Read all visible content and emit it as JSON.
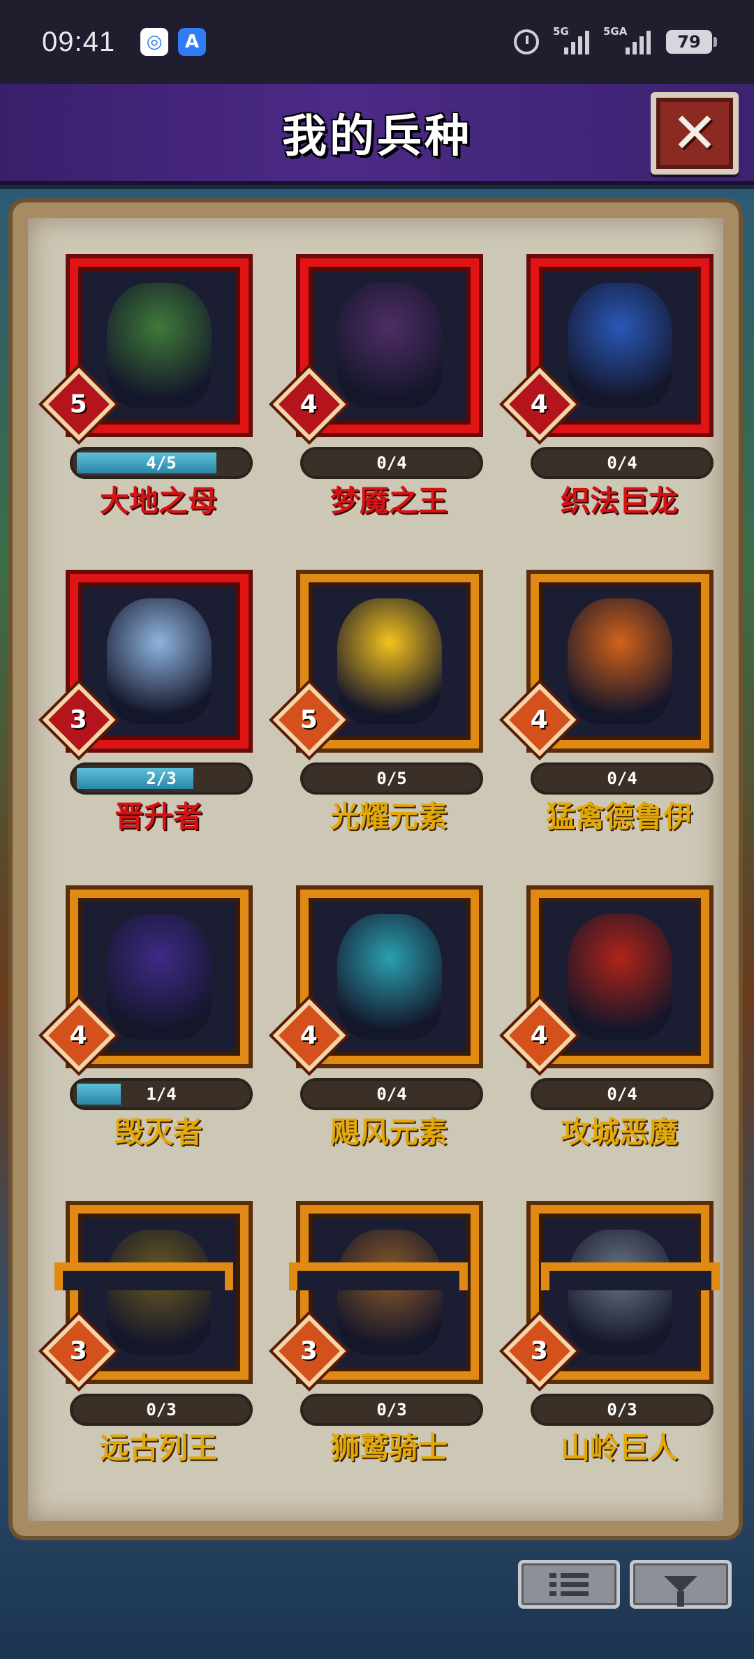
{
  "status_bar": {
    "time": "09:41",
    "battery": "79",
    "signal1_label": "5G",
    "signal2_label": "5GA"
  },
  "header": {
    "title": "我的兵种",
    "close_icon": "close-icon"
  },
  "units": [
    {
      "name": "大地之母",
      "level": "5",
      "progress": "4/5",
      "progress_value": 0.8,
      "rarity": "red"
    },
    {
      "name": "梦魇之王",
      "level": "4",
      "progress": "0/4",
      "progress_value": 0,
      "rarity": "red"
    },
    {
      "name": "织法巨龙",
      "level": "4",
      "progress": "0/4",
      "progress_value": 0,
      "rarity": "red"
    },
    {
      "name": "晋升者",
      "level": "3",
      "progress": "2/3",
      "progress_value": 0.667,
      "rarity": "red"
    },
    {
      "name": "光耀元素",
      "level": "5",
      "progress": "0/5",
      "progress_value": 0,
      "rarity": "gold"
    },
    {
      "name": "猛禽德鲁伊",
      "level": "4",
      "progress": "0/4",
      "progress_value": 0,
      "rarity": "gold"
    },
    {
      "name": "毁灭者",
      "level": "4",
      "progress": "1/4",
      "progress_value": 0.25,
      "rarity": "gold"
    },
    {
      "name": "飓风元素",
      "level": "4",
      "progress": "0/4",
      "progress_value": 0,
      "rarity": "gold"
    },
    {
      "name": "攻城恶魔",
      "level": "4",
      "progress": "0/4",
      "progress_value": 0,
      "rarity": "gold"
    },
    {
      "name": "远古列王",
      "level": "3",
      "progress": "0/3",
      "progress_value": 0,
      "rarity": "gold"
    },
    {
      "name": "狮鹫骑士",
      "level": "3",
      "progress": "0/3",
      "progress_value": 0,
      "rarity": "gold"
    },
    {
      "name": "山岭巨人",
      "level": "3",
      "progress": "0/3",
      "progress_value": 0,
      "rarity": "gold"
    }
  ],
  "art_colors": [
    "#3f7a3a",
    "#4e2d66",
    "#2a58b8",
    "#8fb4e0",
    "#f4c21c",
    "#d2621a",
    "#3e2a86",
    "#2aa0b0",
    "#b02418",
    "#6a5a22",
    "#8a5a2a",
    "#6a7684"
  ],
  "bottom_buttons": {
    "list_icon": "list-icon",
    "filter_icon": "filter-icon"
  }
}
